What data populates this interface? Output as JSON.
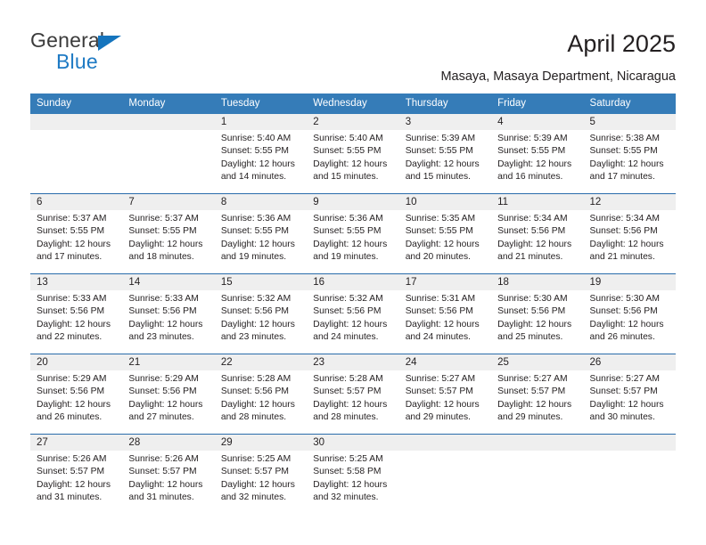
{
  "brand": {
    "name_top": "General",
    "name_bottom": "Blue"
  },
  "header": {
    "title": "April 2025",
    "subtitle": "Masaya, Masaya Department, Nicaragua"
  },
  "colors": {
    "header_blue": "#357cb8",
    "row_divider_blue": "#2a6cab",
    "day_band_gray": "#efefef",
    "brand_blue": "#1e7ac4",
    "text": "#231f20"
  },
  "calendar": {
    "weekdays": [
      "Sunday",
      "Monday",
      "Tuesday",
      "Wednesday",
      "Thursday",
      "Friday",
      "Saturday"
    ],
    "weeks": [
      [
        {
          "day": "",
          "sunrise": "",
          "sunset": "",
          "daylight1": "",
          "daylight2": "",
          "empty": true
        },
        {
          "day": "",
          "sunrise": "",
          "sunset": "",
          "daylight1": "",
          "daylight2": "",
          "empty": true
        },
        {
          "day": "1",
          "sunrise": "Sunrise: 5:40 AM",
          "sunset": "Sunset: 5:55 PM",
          "daylight1": "Daylight: 12 hours",
          "daylight2": "and 14 minutes."
        },
        {
          "day": "2",
          "sunrise": "Sunrise: 5:40 AM",
          "sunset": "Sunset: 5:55 PM",
          "daylight1": "Daylight: 12 hours",
          "daylight2": "and 15 minutes."
        },
        {
          "day": "3",
          "sunrise": "Sunrise: 5:39 AM",
          "sunset": "Sunset: 5:55 PM",
          "daylight1": "Daylight: 12 hours",
          "daylight2": "and 15 minutes."
        },
        {
          "day": "4",
          "sunrise": "Sunrise: 5:39 AM",
          "sunset": "Sunset: 5:55 PM",
          "daylight1": "Daylight: 12 hours",
          "daylight2": "and 16 minutes."
        },
        {
          "day": "5",
          "sunrise": "Sunrise: 5:38 AM",
          "sunset": "Sunset: 5:55 PM",
          "daylight1": "Daylight: 12 hours",
          "daylight2": "and 17 minutes."
        }
      ],
      [
        {
          "day": "6",
          "sunrise": "Sunrise: 5:37 AM",
          "sunset": "Sunset: 5:55 PM",
          "daylight1": "Daylight: 12 hours",
          "daylight2": "and 17 minutes."
        },
        {
          "day": "7",
          "sunrise": "Sunrise: 5:37 AM",
          "sunset": "Sunset: 5:55 PM",
          "daylight1": "Daylight: 12 hours",
          "daylight2": "and 18 minutes."
        },
        {
          "day": "8",
          "sunrise": "Sunrise: 5:36 AM",
          "sunset": "Sunset: 5:55 PM",
          "daylight1": "Daylight: 12 hours",
          "daylight2": "and 19 minutes."
        },
        {
          "day": "9",
          "sunrise": "Sunrise: 5:36 AM",
          "sunset": "Sunset: 5:55 PM",
          "daylight1": "Daylight: 12 hours",
          "daylight2": "and 19 minutes."
        },
        {
          "day": "10",
          "sunrise": "Sunrise: 5:35 AM",
          "sunset": "Sunset: 5:55 PM",
          "daylight1": "Daylight: 12 hours",
          "daylight2": "and 20 minutes."
        },
        {
          "day": "11",
          "sunrise": "Sunrise: 5:34 AM",
          "sunset": "Sunset: 5:56 PM",
          "daylight1": "Daylight: 12 hours",
          "daylight2": "and 21 minutes."
        },
        {
          "day": "12",
          "sunrise": "Sunrise: 5:34 AM",
          "sunset": "Sunset: 5:56 PM",
          "daylight1": "Daylight: 12 hours",
          "daylight2": "and 21 minutes."
        }
      ],
      [
        {
          "day": "13",
          "sunrise": "Sunrise: 5:33 AM",
          "sunset": "Sunset: 5:56 PM",
          "daylight1": "Daylight: 12 hours",
          "daylight2": "and 22 minutes."
        },
        {
          "day": "14",
          "sunrise": "Sunrise: 5:33 AM",
          "sunset": "Sunset: 5:56 PM",
          "daylight1": "Daylight: 12 hours",
          "daylight2": "and 23 minutes."
        },
        {
          "day": "15",
          "sunrise": "Sunrise: 5:32 AM",
          "sunset": "Sunset: 5:56 PM",
          "daylight1": "Daylight: 12 hours",
          "daylight2": "and 23 minutes."
        },
        {
          "day": "16",
          "sunrise": "Sunrise: 5:32 AM",
          "sunset": "Sunset: 5:56 PM",
          "daylight1": "Daylight: 12 hours",
          "daylight2": "and 24 minutes."
        },
        {
          "day": "17",
          "sunrise": "Sunrise: 5:31 AM",
          "sunset": "Sunset: 5:56 PM",
          "daylight1": "Daylight: 12 hours",
          "daylight2": "and 24 minutes."
        },
        {
          "day": "18",
          "sunrise": "Sunrise: 5:30 AM",
          "sunset": "Sunset: 5:56 PM",
          "daylight1": "Daylight: 12 hours",
          "daylight2": "and 25 minutes."
        },
        {
          "day": "19",
          "sunrise": "Sunrise: 5:30 AM",
          "sunset": "Sunset: 5:56 PM",
          "daylight1": "Daylight: 12 hours",
          "daylight2": "and 26 minutes."
        }
      ],
      [
        {
          "day": "20",
          "sunrise": "Sunrise: 5:29 AM",
          "sunset": "Sunset: 5:56 PM",
          "daylight1": "Daylight: 12 hours",
          "daylight2": "and 26 minutes."
        },
        {
          "day": "21",
          "sunrise": "Sunrise: 5:29 AM",
          "sunset": "Sunset: 5:56 PM",
          "daylight1": "Daylight: 12 hours",
          "daylight2": "and 27 minutes."
        },
        {
          "day": "22",
          "sunrise": "Sunrise: 5:28 AM",
          "sunset": "Sunset: 5:56 PM",
          "daylight1": "Daylight: 12 hours",
          "daylight2": "and 28 minutes."
        },
        {
          "day": "23",
          "sunrise": "Sunrise: 5:28 AM",
          "sunset": "Sunset: 5:57 PM",
          "daylight1": "Daylight: 12 hours",
          "daylight2": "and 28 minutes."
        },
        {
          "day": "24",
          "sunrise": "Sunrise: 5:27 AM",
          "sunset": "Sunset: 5:57 PM",
          "daylight1": "Daylight: 12 hours",
          "daylight2": "and 29 minutes."
        },
        {
          "day": "25",
          "sunrise": "Sunrise: 5:27 AM",
          "sunset": "Sunset: 5:57 PM",
          "daylight1": "Daylight: 12 hours",
          "daylight2": "and 29 minutes."
        },
        {
          "day": "26",
          "sunrise": "Sunrise: 5:27 AM",
          "sunset": "Sunset: 5:57 PM",
          "daylight1": "Daylight: 12 hours",
          "daylight2": "and 30 minutes."
        }
      ],
      [
        {
          "day": "27",
          "sunrise": "Sunrise: 5:26 AM",
          "sunset": "Sunset: 5:57 PM",
          "daylight1": "Daylight: 12 hours",
          "daylight2": "and 31 minutes."
        },
        {
          "day": "28",
          "sunrise": "Sunrise: 5:26 AM",
          "sunset": "Sunset: 5:57 PM",
          "daylight1": "Daylight: 12 hours",
          "daylight2": "and 31 minutes."
        },
        {
          "day": "29",
          "sunrise": "Sunrise: 5:25 AM",
          "sunset": "Sunset: 5:57 PM",
          "daylight1": "Daylight: 12 hours",
          "daylight2": "and 32 minutes."
        },
        {
          "day": "30",
          "sunrise": "Sunrise: 5:25 AM",
          "sunset": "Sunset: 5:58 PM",
          "daylight1": "Daylight: 12 hours",
          "daylight2": "and 32 minutes."
        },
        {
          "day": "",
          "sunrise": "",
          "sunset": "",
          "daylight1": "",
          "daylight2": "",
          "empty": true
        },
        {
          "day": "",
          "sunrise": "",
          "sunset": "",
          "daylight1": "",
          "daylight2": "",
          "empty": true
        },
        {
          "day": "",
          "sunrise": "",
          "sunset": "",
          "daylight1": "",
          "daylight2": "",
          "empty": true
        }
      ]
    ]
  }
}
